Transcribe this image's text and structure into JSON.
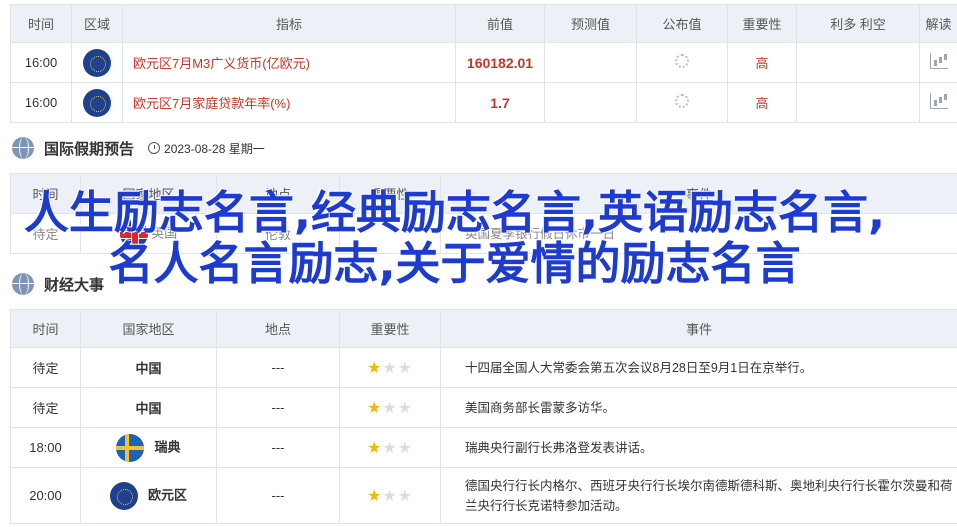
{
  "table1": {
    "headers": [
      "时间",
      "区域",
      "指标",
      "前值",
      "预测值",
      "公布值",
      "重要性",
      "利多 利空",
      "解读"
    ],
    "rows": [
      {
        "time": "16:00",
        "flag": "eu-flag-icon",
        "indicator": "欧元区7月M3广义货币(亿欧元)",
        "previous": "160182.01",
        "importance": "高"
      },
      {
        "time": "16:00",
        "flag": "eu-flag-icon",
        "indicator": "欧元区7月家庭贷款年率(%)",
        "previous": "1.7",
        "importance": "高"
      }
    ]
  },
  "holiday_section": {
    "title": "国际假期预告",
    "date": "2023-08-28 星期一"
  },
  "table2": {
    "headers": [
      "时间",
      "国家地区",
      "地点",
      "重要性",
      "事件"
    ],
    "rows": [
      {
        "time": "待定",
        "region": "英国",
        "place": "伦敦",
        "event": "英国夏季银行假日休市一日"
      }
    ],
    "partial_row_label": "财经大事"
  },
  "table3": {
    "headers": [
      "时间",
      "国家地区",
      "地点",
      "重要性",
      "事件"
    ],
    "rows": [
      {
        "time": "待定",
        "region": "中国",
        "flag": "",
        "place": "---",
        "stars": 1,
        "event": "十四届全国人大常委会第五次会议8月28日至9月1日在京举行。"
      },
      {
        "time": "待定",
        "region": "中国",
        "flag": "",
        "place": "---",
        "stars": 1,
        "event": "美国商务部长雷蒙多访华。"
      },
      {
        "time": "18:00",
        "region": "瑞典",
        "flag": "sweden-flag-icon",
        "place": "---",
        "stars": 1,
        "event": "瑞典央行副行长弗洛登发表讲话。"
      },
      {
        "time": "20:00",
        "region": "欧元区",
        "flag": "eu-flag-icon",
        "place": "---",
        "stars": 1,
        "event": "德国央行行长内格尔、西班牙央行行长埃尔南德斯德科斯、奥地利央行行长霍尔茨曼和荷兰央行行长克诺特参加活动。"
      }
    ]
  },
  "overlay": {
    "text": "人生励志名言,经典励志名言,英语励志名言,名人名言励志,关于爱情的励志名言"
  },
  "colors": {
    "accent_red": "#c0392b",
    "header_bg": "#edf1f7",
    "overlay_blue": "#1e3bd0",
    "star": "#f0b90b"
  }
}
